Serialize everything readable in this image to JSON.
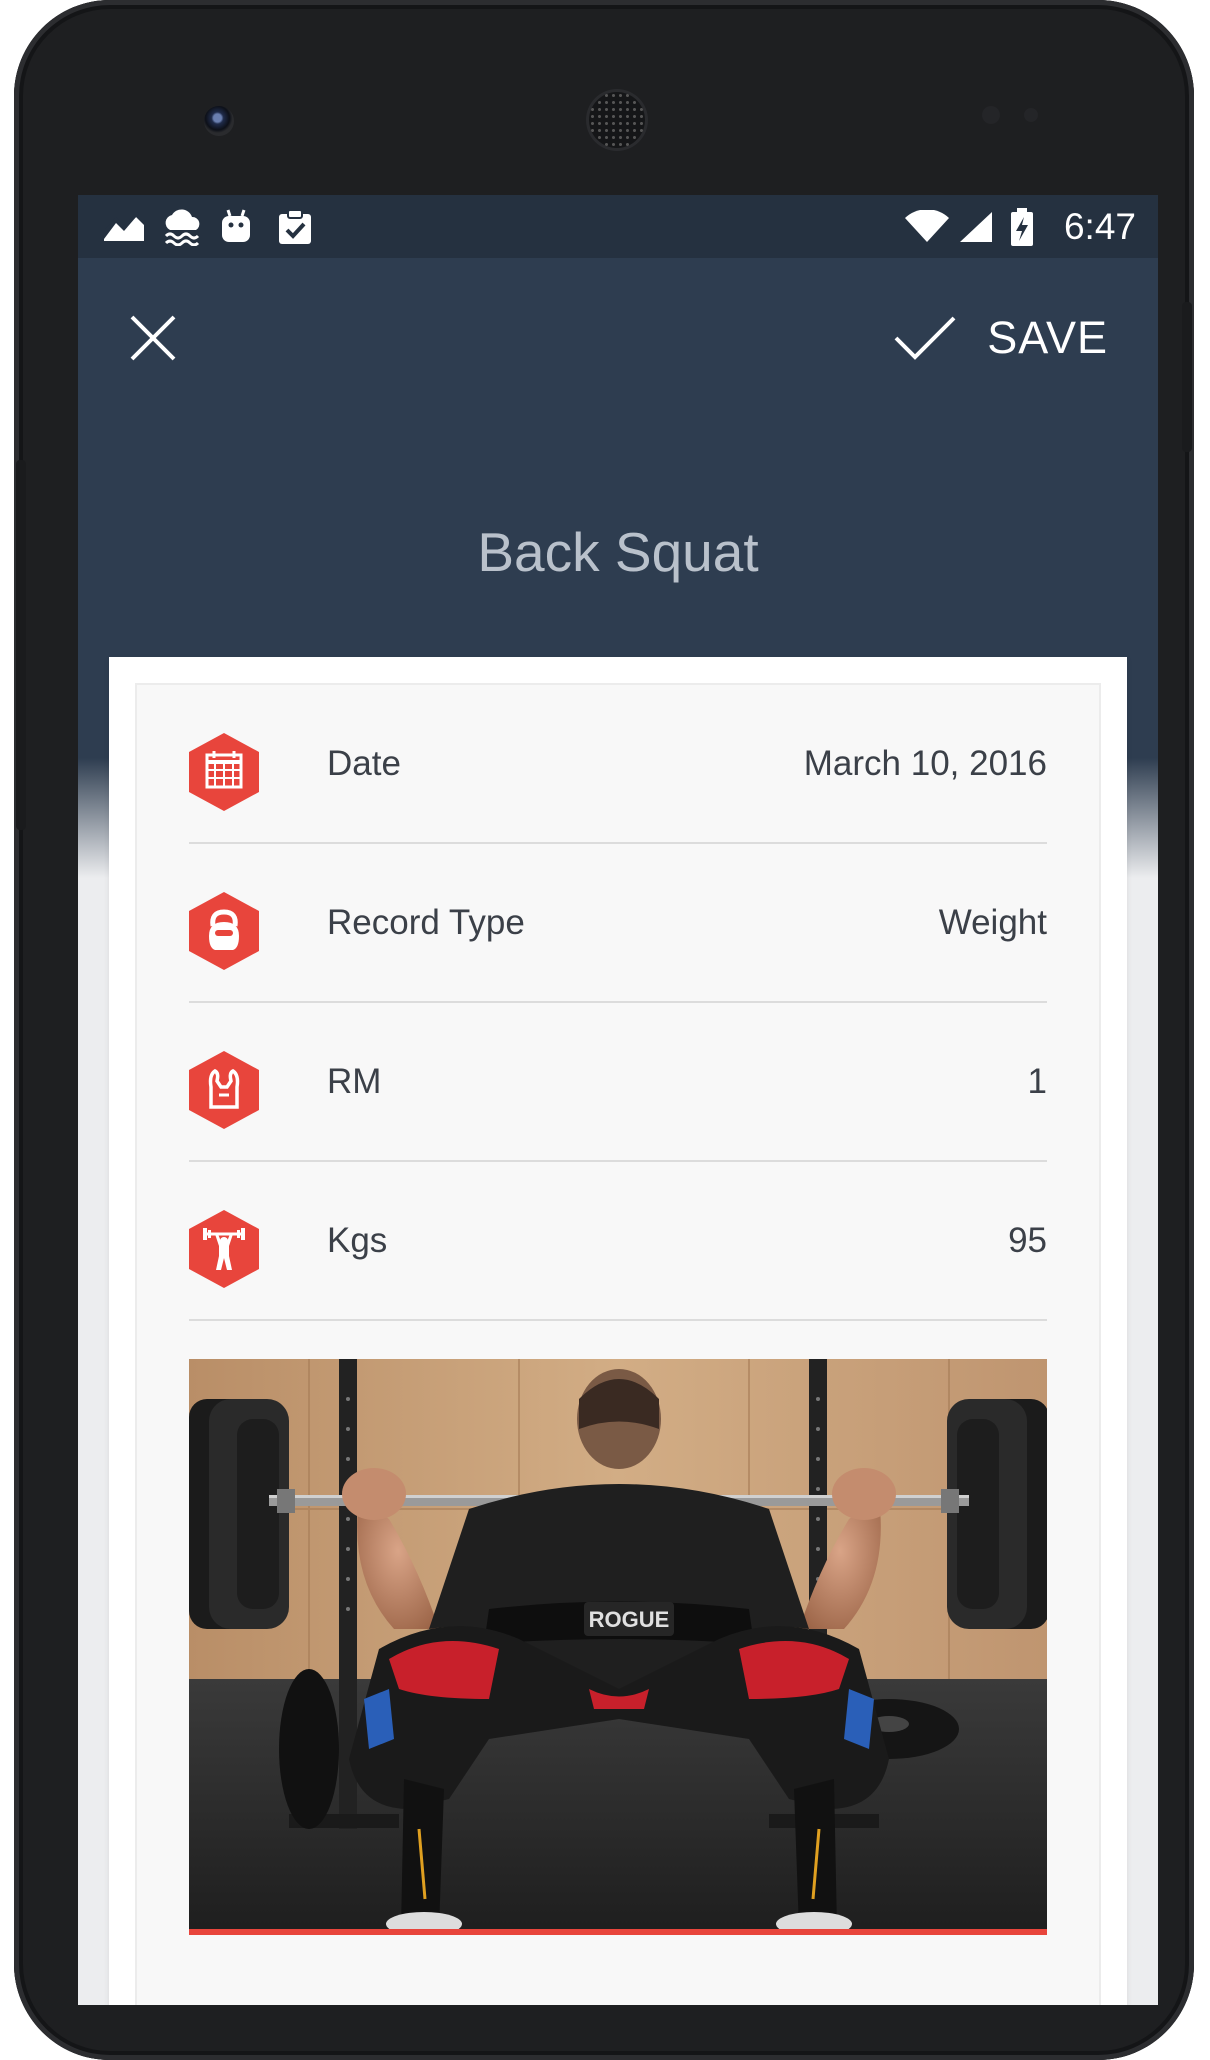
{
  "status_bar": {
    "time": "6:47",
    "left_icons": [
      "chart-icon",
      "weather-icon",
      "android-icon",
      "clipboard-icon"
    ],
    "right_icons": [
      "wifi-icon",
      "signal-icon",
      "battery-icon"
    ]
  },
  "toolbar": {
    "save_label": "SAVE"
  },
  "record": {
    "title": "Back Squat"
  },
  "fields": [
    {
      "label": "Date",
      "value": "March 10, 2016",
      "icon": "calendar-icon"
    },
    {
      "label": "Record Type",
      "value": "Weight",
      "icon": "kettlebell-icon"
    },
    {
      "label": "RM",
      "value": "1",
      "icon": "flexed-arms-icon"
    },
    {
      "label": "Kgs",
      "value": "95",
      "icon": "weightlifter-icon"
    }
  ],
  "photo": {
    "belt_text": "ROGUE"
  },
  "colors": {
    "header": "#2e3d50",
    "status_bar": "#253140",
    "accent": "#e8453c",
    "title_text": "#b9c1cb",
    "body_text": "#3b4048"
  }
}
